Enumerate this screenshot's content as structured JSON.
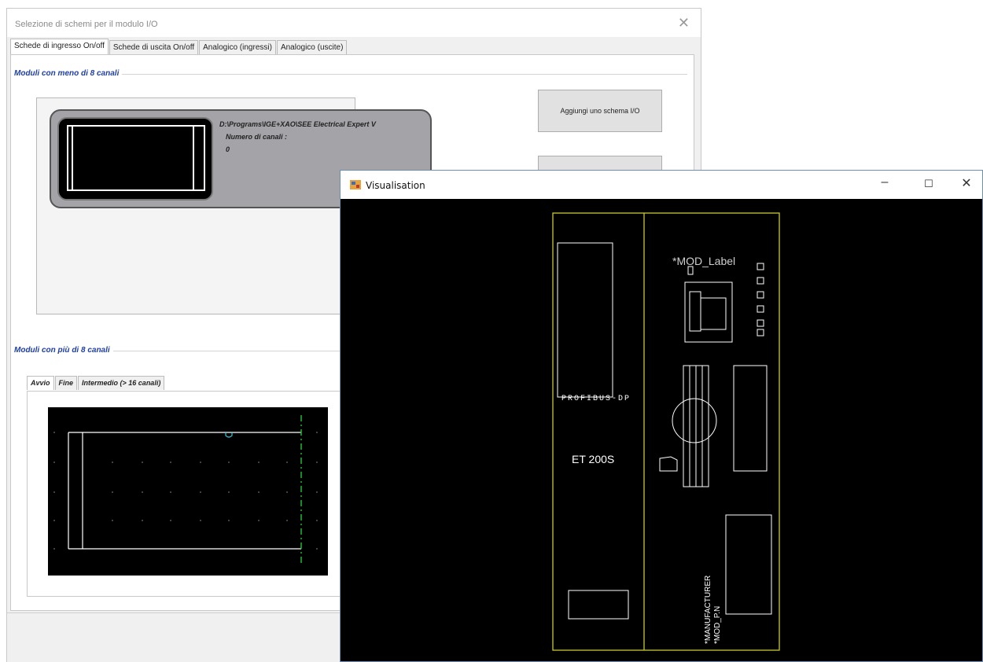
{
  "dialog": {
    "title": "Selezione di schemi per il modulo I/O",
    "close_glyph": "✕",
    "tabs": [
      "Schede di ingresso On/off",
      "Schede di uscita On/off",
      "Analogico (ingressi)",
      "Analogico (uscite)"
    ],
    "group_few": {
      "title": "Moduli con meno di 8 canali",
      "card": {
        "path": "D:\\Programs\\IGE+XAO\\SEE Electrical Expert V",
        "channels_label": "Numero di canali :",
        "channels_value": "0"
      },
      "add_button": "Aggiungi uno schema I/O"
    },
    "group_many": {
      "title": "Moduli con più di 8 canali",
      "subtabs": [
        "Avvio",
        "Fine",
        "Intermedio (> 16 canali)"
      ]
    }
  },
  "visualisation": {
    "title": "Visualisation",
    "minimize_glyph": "–",
    "maximize_glyph": "☐",
    "close_glyph": "✕",
    "labels": {
      "mod_label": "*MOD_Label",
      "profibus": "PROFIBUS-DP",
      "et200s": "ET 200S",
      "manufacturer": "*MANUFACTURER",
      "mod_pn": "*MOD_P.N"
    },
    "colors": {
      "outline": "#c8c832",
      "drawing": "#ffffff",
      "background": "#000000"
    }
  }
}
